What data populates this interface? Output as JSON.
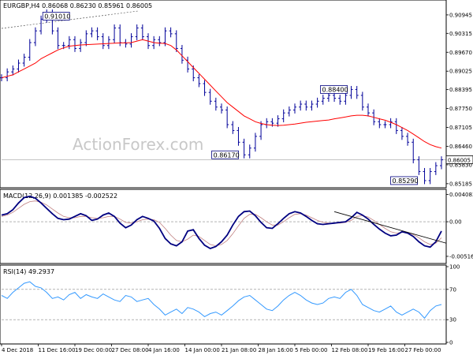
{
  "chart_data": [
    {
      "type": "ohlc",
      "title": "EURGBP,H4  0.86068 0.86230 0.85961 0.86005",
      "ylim": [
        0.851,
        0.914
      ],
      "y_ticks": [
        "0.90945",
        "0.90315",
        "0.89670",
        "0.89025",
        "0.88395",
        "0.87750",
        "0.87105",
        "0.86460",
        "0.85830",
        "0.85185"
      ],
      "current_price": "0.86005",
      "annotations": [
        "0.91010",
        "0.86170",
        "0.88400",
        "0.85290"
      ],
      "watermark": "ActionForex.com",
      "series": [
        {
          "name": "price",
          "values": [
            0.888,
            0.89,
            0.891,
            0.893,
            0.895,
            0.9,
            0.904,
            0.908,
            0.9101,
            0.904,
            0.899,
            0.899,
            0.901,
            0.898,
            0.9,
            0.903,
            0.904,
            0.902,
            0.899,
            0.901,
            0.905,
            0.9,
            0.8995,
            0.902,
            0.905,
            0.902,
            0.899,
            0.901,
            0.9,
            0.904,
            0.903,
            0.898,
            0.894,
            0.891,
            0.888,
            0.886,
            0.883,
            0.88,
            0.878,
            0.877,
            0.872,
            0.87,
            0.866,
            0.8617,
            0.864,
            0.868,
            0.872,
            0.873,
            0.8725,
            0.874,
            0.876,
            0.877,
            0.878,
            0.879,
            0.878,
            0.879,
            0.88,
            0.881,
            0.882,
            0.881,
            0.88,
            0.882,
            0.884,
            0.882,
            0.878,
            0.876,
            0.873,
            0.872,
            0.872,
            0.873,
            0.87,
            0.868,
            0.866,
            0.86,
            0.856,
            0.8529,
            0.856,
            0.858,
            0.86
          ]
        },
        {
          "name": "sma",
          "values": [
            0.888,
            0.8885,
            0.889,
            0.89,
            0.891,
            0.892,
            0.893,
            0.8945,
            0.8955,
            0.8965,
            0.8975,
            0.8982,
            0.8988,
            0.899,
            0.8992,
            0.8993,
            0.8994,
            0.8995,
            0.8996,
            0.8997,
            0.8998,
            0.8999,
            0.8999,
            0.9,
            0.9005,
            0.901,
            0.9005,
            0.9,
            0.8998,
            0.8997,
            0.899,
            0.8975,
            0.8955,
            0.8935,
            0.8915,
            0.8895,
            0.8875,
            0.8855,
            0.8835,
            0.8815,
            0.8795,
            0.878,
            0.8765,
            0.875,
            0.874,
            0.873,
            0.8724,
            0.872,
            0.8718,
            0.8717,
            0.8718,
            0.872,
            0.8722,
            0.8725,
            0.8728,
            0.873,
            0.8732,
            0.8734,
            0.8736,
            0.874,
            0.8743,
            0.8746,
            0.875,
            0.8752,
            0.8752,
            0.875,
            0.8745,
            0.874,
            0.8735,
            0.8728,
            0.872,
            0.871,
            0.87,
            0.8688,
            0.8675,
            0.8662,
            0.8652,
            0.8645,
            0.864
          ]
        }
      ],
      "colors": {
        "price": "#000099",
        "sma": "#ff0000"
      }
    },
    {
      "type": "line",
      "title": "MACD(12,26,9) 0.001385 -0.002522",
      "ylim": [
        -0.006,
        0.0046
      ],
      "y_ticks": [
        "0.004083",
        "0.00",
        "-0.005169"
      ],
      "series": [
        {
          "name": "macd",
          "values": [
            0.001,
            0.0012,
            0.0018,
            0.0028,
            0.0036,
            0.0038,
            0.0035,
            0.0028,
            0.002,
            0.0012,
            0.0005,
            0.0003,
            0.0004,
            0.0008,
            0.0012,
            0.0009,
            0.0002,
            0.0004,
            0.001,
            0.0013,
            0.0008,
            -0.0002,
            -0.0009,
            -0.0005,
            0.0003,
            0.0008,
            0.0005,
            0.0001,
            -0.001,
            -0.0025,
            -0.0033,
            -0.0036,
            -0.003,
            -0.0014,
            -0.0012,
            -0.0025,
            -0.0035,
            -0.004,
            -0.0037,
            -0.003,
            -0.002,
            -0.0005,
            0.0008,
            0.0015,
            0.0016,
            0.0009,
            -0.0001,
            -0.0009,
            -0.001,
            -0.0003,
            0.0005,
            0.0012,
            0.0015,
            0.0013,
            0.0008,
            0.0002,
            -0.0003,
            -0.0004,
            -0.0003,
            -0.0002,
            -0.0001,
            0.0,
            0.0006,
            0.0014,
            0.001,
            0.0004,
            -0.0004,
            -0.0011,
            -0.0017,
            -0.0021,
            -0.002,
            -0.0015,
            -0.0017,
            -0.0022,
            -0.003,
            -0.0036,
            -0.0038,
            -0.003,
            -0.0014
          ]
        },
        {
          "name": "signal",
          "values": [
            0.0008,
            0.001,
            0.0014,
            0.002,
            0.0026,
            0.003,
            0.0031,
            0.0029,
            0.0025,
            0.0019,
            0.0013,
            0.0008,
            0.0006,
            0.0006,
            0.0008,
            0.0008,
            0.0006,
            0.0005,
            0.0006,
            0.0008,
            0.0008,
            0.0004,
            -0.0001,
            -0.0002,
            0.0,
            0.0003,
            0.0004,
            0.0003,
            -0.0001,
            -0.001,
            -0.002,
            -0.0028,
            -0.003,
            -0.0026,
            -0.002,
            -0.0022,
            -0.0028,
            -0.0034,
            -0.0036,
            -0.0034,
            -0.0028,
            -0.0018,
            -0.0006,
            0.0005,
            0.0011,
            0.0011,
            0.0006,
            0.0,
            -0.0005,
            -0.0005,
            0.0,
            0.0006,
            0.0011,
            0.0012,
            0.001,
            0.0006,
            0.0002,
            -0.0001,
            -0.0002,
            -0.0002,
            -0.0002,
            -0.0001,
            0.0002,
            0.0008,
            0.0009,
            0.0007,
            0.0002,
            -0.0004,
            -0.001,
            -0.0015,
            -0.0017,
            -0.0016,
            -0.0016,
            -0.0019,
            -0.0024,
            -0.003,
            -0.0034,
            -0.0032,
            -0.0024
          ]
        }
      ],
      "colors": {
        "macd": "#000080",
        "signal": "#c08080",
        "trendline": "#000000"
      }
    },
    {
      "type": "line",
      "title": "RSI(14) 49.2937",
      "ylim": [
        0,
        100
      ],
      "y_ticks": [
        "100",
        "70",
        "30",
        "0"
      ],
      "series": [
        {
          "name": "rsi",
          "values": [
            62,
            58,
            66,
            72,
            78,
            80,
            74,
            72,
            66,
            58,
            60,
            56,
            63,
            66,
            58,
            63,
            60,
            58,
            64,
            60,
            56,
            54,
            62,
            60,
            54,
            56,
            58,
            50,
            44,
            36,
            40,
            44,
            38,
            46,
            44,
            40,
            34,
            38,
            40,
            36,
            42,
            48,
            55,
            60,
            62,
            56,
            50,
            44,
            42,
            48,
            56,
            62,
            66,
            62,
            56,
            52,
            50,
            52,
            58,
            60,
            58,
            66,
            70,
            62,
            50,
            46,
            42,
            40,
            44,
            48,
            40,
            36,
            40,
            44,
            40,
            32,
            42,
            48,
            50
          ]
        }
      ],
      "colors": {
        "rsi": "#3399ff"
      }
    }
  ],
  "x_labels": [
    "4 Dec 2018",
    "11 Dec 16:00",
    "19 Dec 00:00",
    "27 Dec 08:00",
    "4 Jan 16:00",
    "14 Jan 00:00",
    "21 Jan 08:00",
    "28 Jan 16:00",
    "5 Feb 00:00",
    "12 Feb 08:00",
    "19 Feb 16:00",
    "27 Feb 00:00"
  ]
}
